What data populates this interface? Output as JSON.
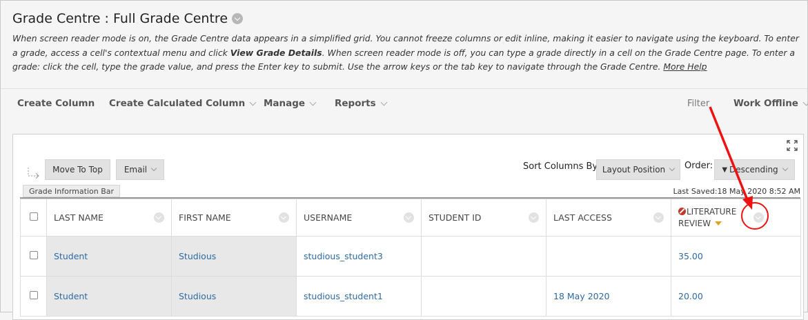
{
  "header": {
    "title": "Grade Centre : Full Grade Centre",
    "instructions_part1": "When screen reader mode is on, the Grade Centre data appears in a simplified grid. You cannot freeze columns or edit inline, making it easier to navigate using the keyboard. To enter a grade, access a cell's contextual menu and click ",
    "instructions_bold": "View Grade Details",
    "instructions_part2": ". When screen reader mode is off, you can type a grade directly in a cell on the Grade Centre page. To enter a grade: click the cell, type the grade value, and press the Enter key to submit. Use the arrow keys or the tab key to navigate through the Grade Centre. ",
    "more_help": "More Help"
  },
  "action_bar": {
    "create_column": "Create Column",
    "create_calculated_column": "Create Calculated Column",
    "manage": "Manage",
    "reports": "Reports",
    "filter": "Filter",
    "work_offline": "Work Offline"
  },
  "toolbar": {
    "move_to_top": "Move To Top",
    "email": "Email",
    "sort_columns_by": "Sort Columns By:",
    "layout_position": "Layout Position",
    "order": "Order:",
    "descending": "Descending"
  },
  "info_bar": {
    "tab": "Grade Information Bar",
    "last_saved": "Last Saved:18 May 2020 8:52 AM"
  },
  "grid": {
    "columns": {
      "last_name": "LAST NAME",
      "first_name": "FIRST NAME",
      "username": "USERNAME",
      "student_id": "STUDENT ID",
      "last_access": "LAST ACCESS",
      "literature_review": "LITERATURE REVIEW"
    },
    "rows": [
      {
        "last_name": "Student",
        "first_name": "Studious",
        "username": "studious_student3",
        "student_id": "",
        "last_access": "",
        "literature_review": "35.00"
      },
      {
        "last_name": "Student",
        "first_name": "Studious",
        "username": "studious_student1",
        "student_id": "",
        "last_access": "18 May 2020",
        "literature_review": "20.00"
      }
    ]
  },
  "colors": {
    "link": "#2d6aa3",
    "annotation": "#e11111",
    "sort_indicator": "#e5a11b"
  }
}
